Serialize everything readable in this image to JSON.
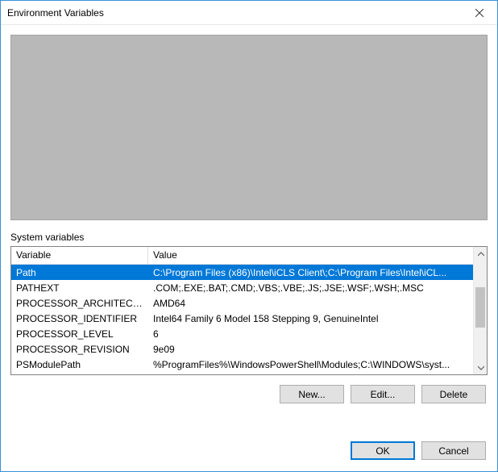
{
  "window": {
    "title": "Environment Variables"
  },
  "group": {
    "label": "System variables"
  },
  "columns": {
    "variable": "Variable",
    "value": "Value"
  },
  "rows": [
    {
      "name": "Path",
      "value": "C:\\Program Files (x86)\\Intel\\iCLS Client\\;C:\\Program Files\\Intel\\iCL...",
      "selected": true
    },
    {
      "name": "PATHEXT",
      "value": ".COM;.EXE;.BAT;.CMD;.VBS;.VBE;.JS;.JSE;.WSF;.WSH;.MSC",
      "selected": false
    },
    {
      "name": "PROCESSOR_ARCHITECTURE",
      "value": "AMD64",
      "selected": false
    },
    {
      "name": "PROCESSOR_IDENTIFIER",
      "value": "Intel64 Family 6 Model 158 Stepping 9, GenuineIntel",
      "selected": false
    },
    {
      "name": "PROCESSOR_LEVEL",
      "value": "6",
      "selected": false
    },
    {
      "name": "PROCESSOR_REVISION",
      "value": "9e09",
      "selected": false
    },
    {
      "name": "PSModulePath",
      "value": "%ProgramFiles%\\WindowsPowerShell\\Modules;C:\\WINDOWS\\syst...",
      "selected": false
    }
  ],
  "buttons": {
    "new": "New...",
    "edit": "Edit...",
    "delete": "Delete",
    "ok": "OK",
    "cancel": "Cancel"
  }
}
